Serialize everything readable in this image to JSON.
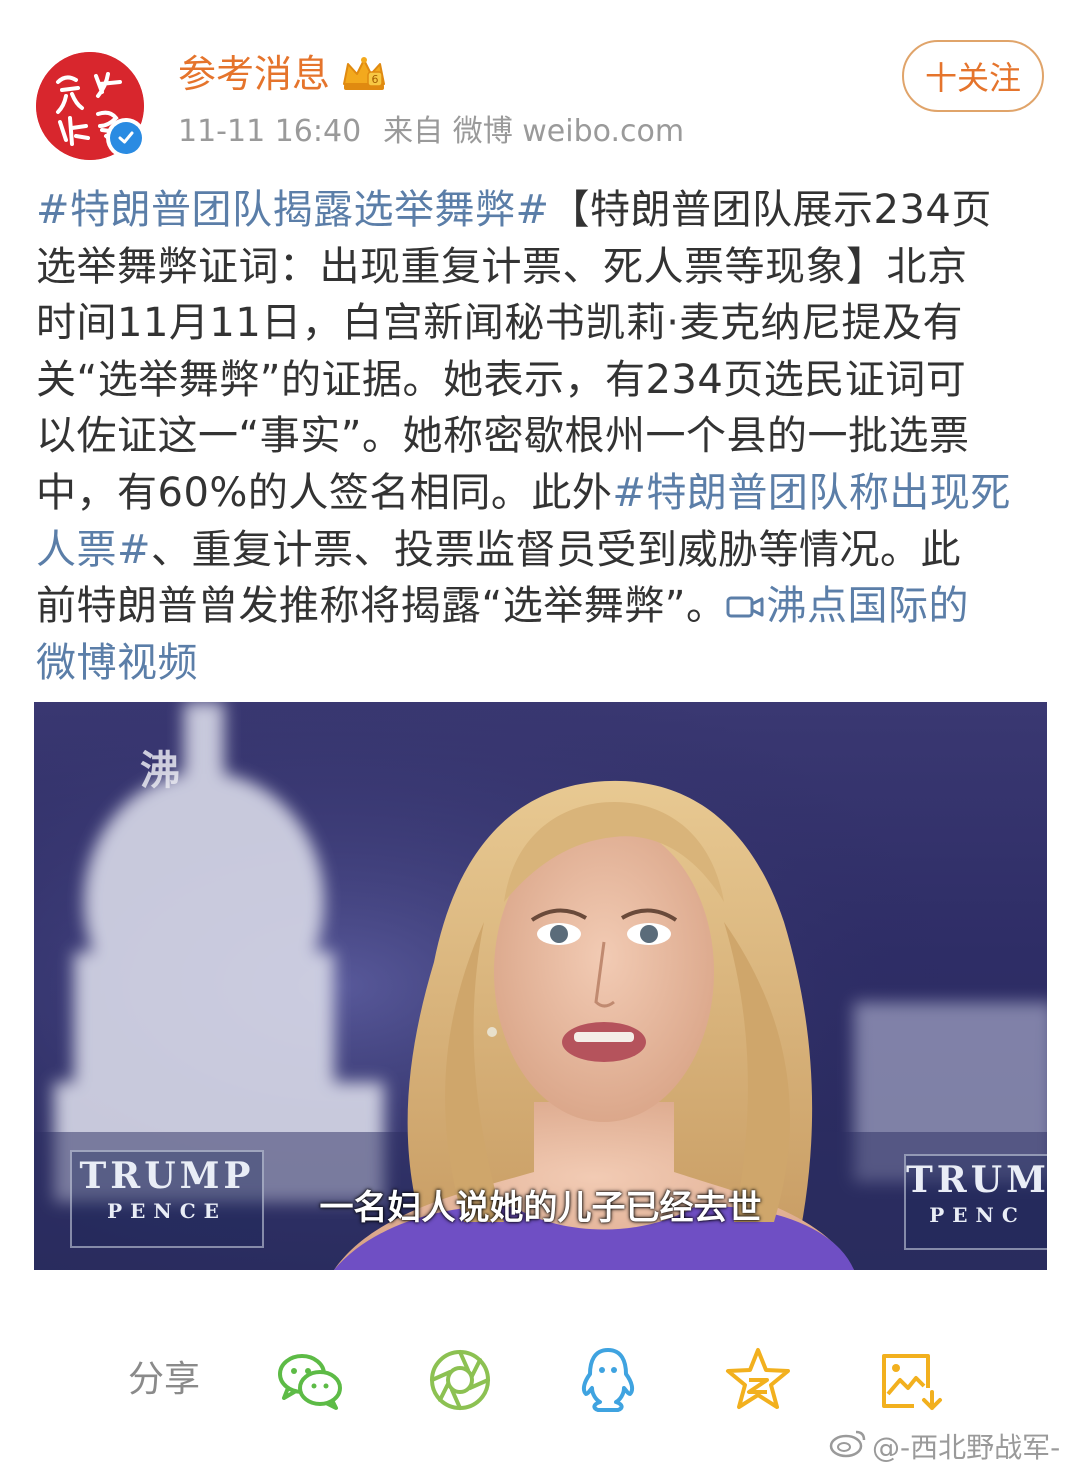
{
  "header": {
    "username": "参考消息",
    "timestamp": "11-11 16:40",
    "source": "来自 微博 weibo.com",
    "follow_label": "十关注",
    "avatar_icon": "cankao-xiaoxi-logo",
    "badge_icon": "verified-icon",
    "level_icon": "crown-icon"
  },
  "post": {
    "lines": [
      [
        {
          "t": "#特朗普团队揭露选举舞弊#",
          "link": true
        },
        {
          "t": "【特朗普团队展示234页",
          "link": false
        }
      ],
      [
        {
          "t": "选举舞弊证词：出现重复计票、死人票等现象】北京",
          "link": false
        }
      ],
      [
        {
          "t": "时间11月11日，白宫新闻秘书凯莉·麦克纳尼提及有",
          "link": false
        }
      ],
      [
        {
          "t": "关“选举舞弊”的证据。她表示，有234页选民证词可",
          "link": false
        }
      ],
      [
        {
          "t": "以佐证这一“事实”。她称密歇根州一个县的一批选票",
          "link": false
        }
      ],
      [
        {
          "t": "中，有60%的人签名相同。此外",
          "link": false
        },
        {
          "t": "#特朗普团队称出现死",
          "link": true
        }
      ],
      [
        {
          "t": "人票#",
          "link": true
        },
        {
          "t": "、重复计票、投票监督员受到威胁等情况。此",
          "link": false
        }
      ],
      [
        {
          "t": "前特朗普曾发推称将揭露“选举舞弊”。",
          "link": false
        },
        {
          "t": "沸点国际的",
          "link": true,
          "icon": true
        }
      ],
      [
        {
          "t": "微博视频",
          "link": true
        }
      ]
    ]
  },
  "video": {
    "subtitle": "一名妇人说她的儿子已经去世",
    "channel_mark": "沸",
    "sign_left": [
      "TRUMP",
      "PENCE"
    ],
    "sign_right": [
      "TRUM",
      "PENC"
    ]
  },
  "share": {
    "label": "分享",
    "icons": [
      "wechat-icon",
      "moments-icon",
      "qq-icon",
      "qzone-icon",
      "save-image-icon"
    ]
  },
  "footer_watermark": "@-西北野战军-",
  "colors": {
    "orange": "#e5742c",
    "link": "#5b7ea8",
    "wechat_green": "#5dbb46",
    "qq_blue": "#3fa3e0",
    "qzone_yellow": "#f2b01e"
  }
}
